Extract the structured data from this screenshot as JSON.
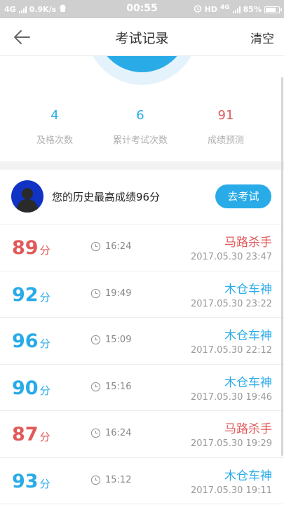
{
  "status_bar": {
    "network": "4G",
    "speed": "0.9K/s",
    "time": "00:55",
    "hd": "HD",
    "network2": "4G",
    "battery": "85%",
    "battery_level": 0.85
  },
  "nav": {
    "title": "考试记录",
    "clear_label": "清空"
  },
  "summary": {
    "stats": [
      {
        "value": "4",
        "label": "及格次数",
        "color": "#29abe8"
      },
      {
        "value": "6",
        "label": "累计考试次数",
        "color": "#29abe8"
      },
      {
        "value": "91",
        "label": "成绩预测",
        "color": "#e05a5a"
      }
    ]
  },
  "best": {
    "text": "您的历史最高成绩96分",
    "button_label": "去考试"
  },
  "records": [
    {
      "score": "89",
      "unit": "分",
      "duration": "16:24",
      "title": "马路杀手",
      "date": "2017.05.30  23:47",
      "tone": "red"
    },
    {
      "score": "92",
      "unit": "分",
      "duration": "19:49",
      "title": "木仓车神",
      "date": "2017.05.30  23:22",
      "tone": "blue"
    },
    {
      "score": "96",
      "unit": "分",
      "duration": "15:09",
      "title": "木仓车神",
      "date": "2017.05.30  22:12",
      "tone": "blue"
    },
    {
      "score": "90",
      "unit": "分",
      "duration": "15:16",
      "title": "木仓车神",
      "date": "2017.05.30  19:46",
      "tone": "blue"
    },
    {
      "score": "87",
      "unit": "分",
      "duration": "16:24",
      "title": "马路杀手",
      "date": "2017.05.30  19:29",
      "tone": "red"
    },
    {
      "score": "93",
      "unit": "分",
      "duration": "15:12",
      "title": "木仓车神",
      "date": "2017.05.30  19:11",
      "tone": "blue"
    }
  ],
  "colors": {
    "accent": "#29abe8",
    "fail": "#e05a5a"
  }
}
